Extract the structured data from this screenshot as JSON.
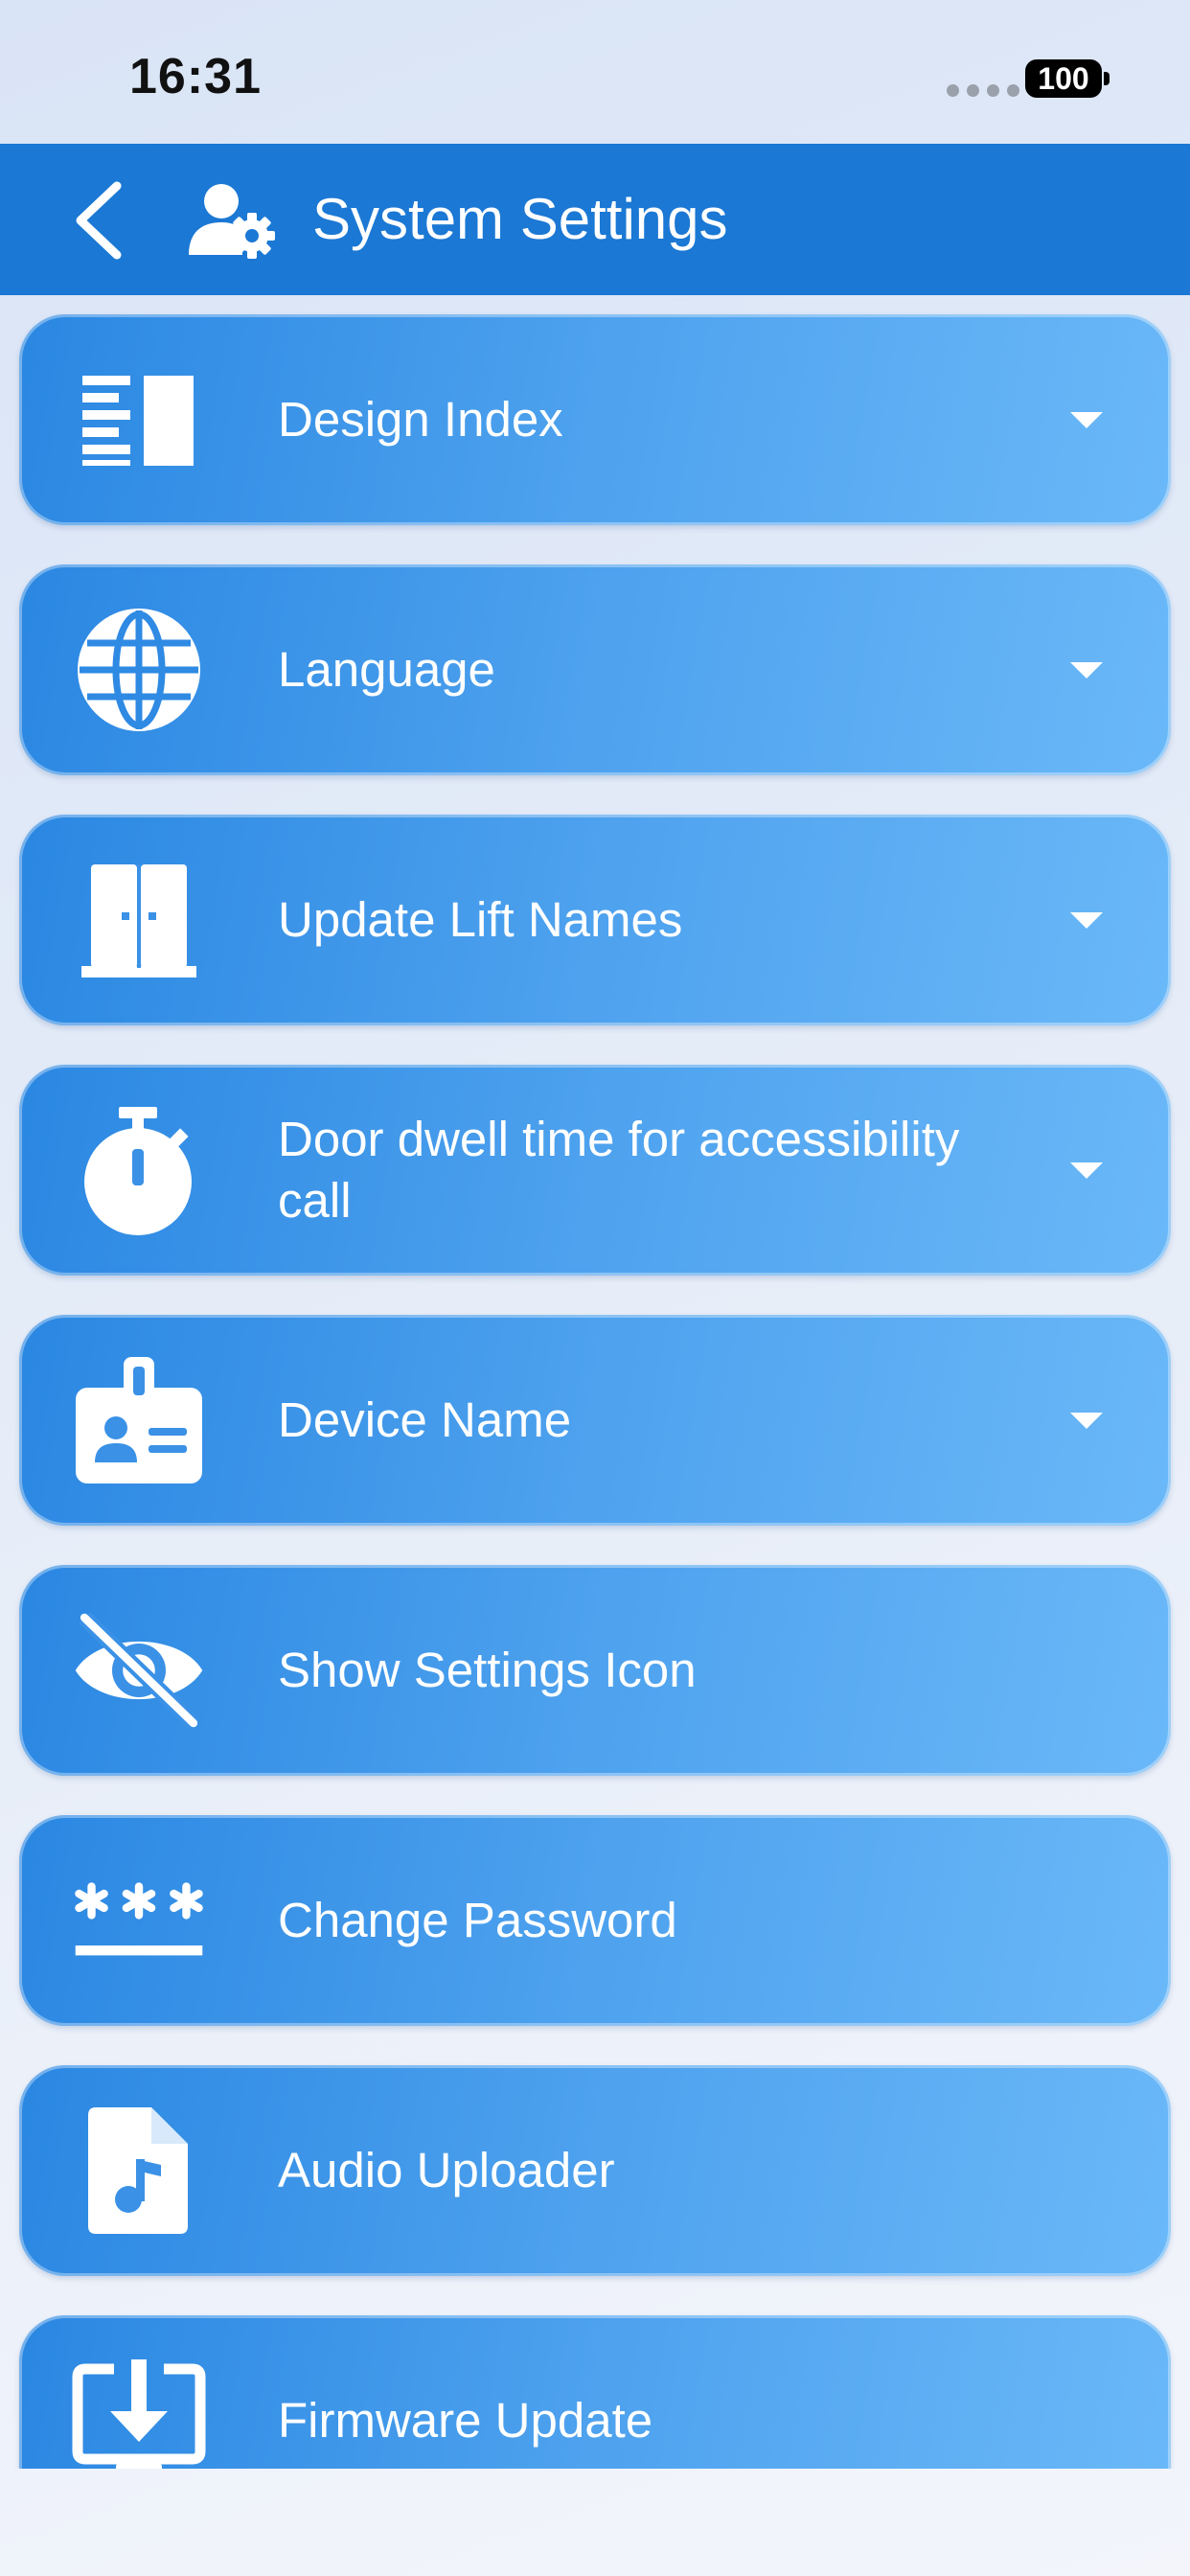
{
  "status_bar": {
    "time": "16:31",
    "battery": "100"
  },
  "header": {
    "title": "System Settings"
  },
  "items": [
    {
      "label": "Design Index",
      "icon": "design-index-icon",
      "has_dropdown": true
    },
    {
      "label": "Language",
      "icon": "globe-icon",
      "has_dropdown": true
    },
    {
      "label": "Update Lift Names",
      "icon": "lift-doors-icon",
      "has_dropdown": true
    },
    {
      "label": "Door dwell time for accessibility call",
      "icon": "stopwatch-icon",
      "has_dropdown": true
    },
    {
      "label": "Device Name",
      "icon": "id-badge-icon",
      "has_dropdown": true
    },
    {
      "label": "Show Settings Icon",
      "icon": "eye-slash-icon",
      "has_dropdown": false
    },
    {
      "label": "Change Password",
      "icon": "password-icon",
      "has_dropdown": false
    },
    {
      "label": "Audio Uploader",
      "icon": "audio-file-icon",
      "has_dropdown": false
    },
    {
      "label": "Firmware Update",
      "icon": "download-monitor-icon",
      "has_dropdown": false
    }
  ],
  "colors": {
    "header_bg": "#1b78d4",
    "item_start": "#2a87e2",
    "item_end": "#6ab8f8",
    "text": "#ffffff"
  }
}
